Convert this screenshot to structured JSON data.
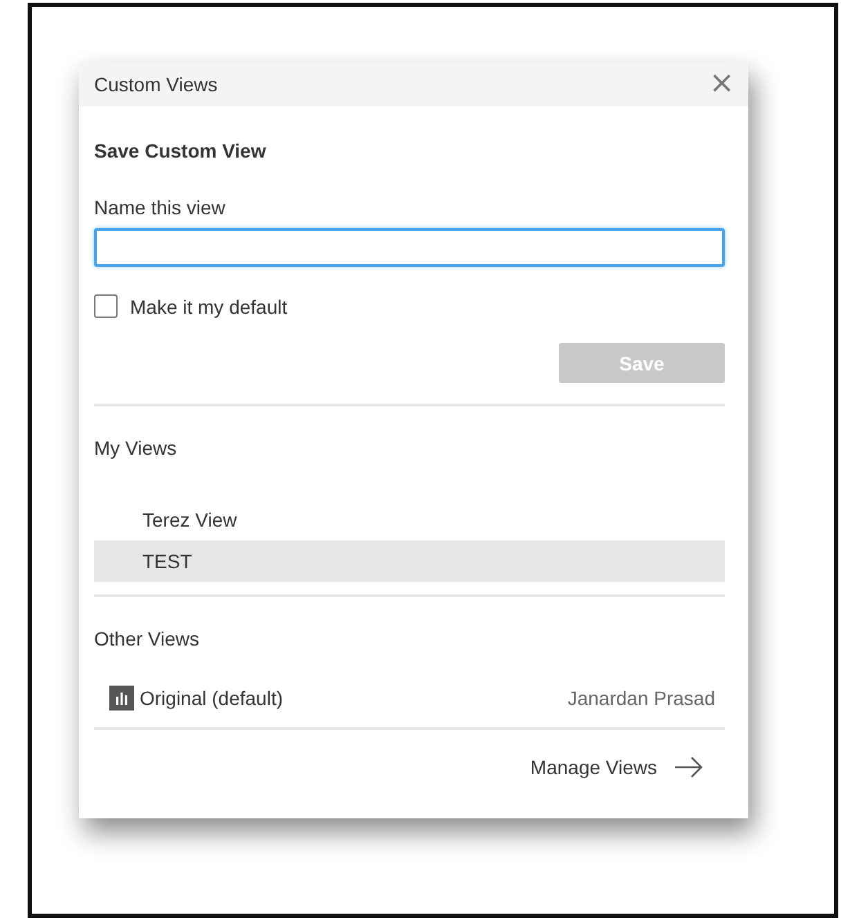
{
  "dialog": {
    "title": "Custom Views",
    "close": "×"
  },
  "save_section": {
    "heading": "Save Custom View",
    "name_label": "Name this view",
    "name_field": {
      "focused": true
    },
    "default_checkbox": {
      "label": "Make it my default",
      "checked": false
    },
    "save_button": {
      "label": "Save",
      "disabled": true
    }
  },
  "my_views": {
    "heading": "My Views",
    "items": [
      {
        "label": "Terez View",
        "selected": false
      },
      {
        "label": "TEST",
        "selected": true
      }
    ]
  },
  "other_views": {
    "heading": "Other Views",
    "items": [
      {
        "label": "Original (default)",
        "owner": "Janardan Prasad"
      }
    ]
  },
  "footer": {
    "link": "Manage Views"
  }
}
